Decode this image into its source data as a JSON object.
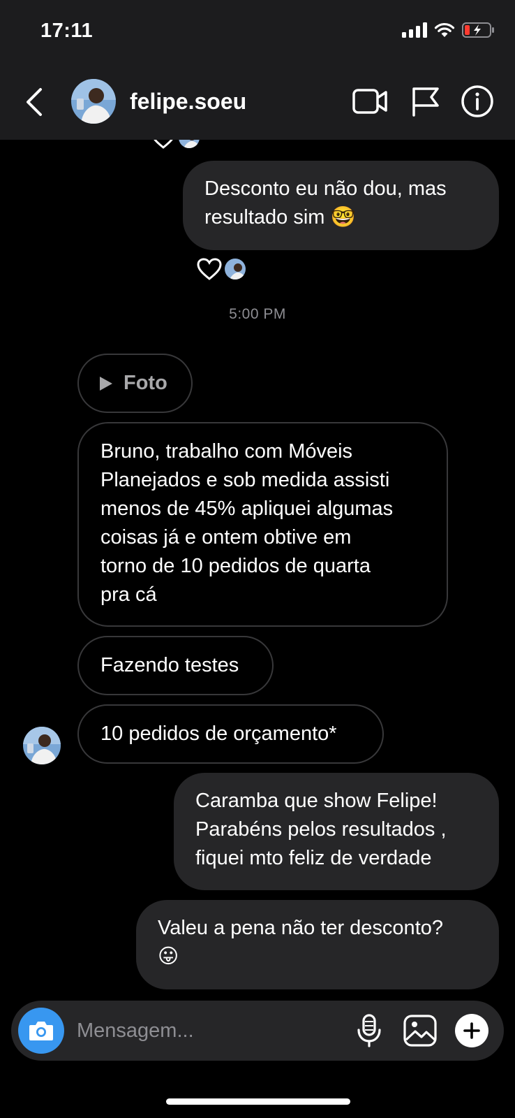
{
  "status_bar": {
    "time": "17:11"
  },
  "header": {
    "username": "felipe.soeu"
  },
  "messages": [
    {
      "text": "Desconto eu não dou, mas\nresultado sim 🤓"
    },
    {
      "text": "Bruno, trabalho com Móveis\nPlanejados e sob medida assisti\nmenos de 45% apliquei algumas\ncoisas já e ontem obtive em\ntorno de 10 pedidos de quarta\npra cá"
    },
    {
      "text": "Fazendo testes"
    },
    {
      "text": "10 pedidos de orçamento*"
    },
    {
      "text": "Caramba que show Felipe!\nParabéns pelos resultados ,\nfiquei mto feliz de verdade"
    },
    {
      "text": "Valeu a pena não ter desconto?\n😛"
    }
  ],
  "timestamp": "5:00 PM",
  "media_message": {
    "label": "Foto"
  },
  "composer": {
    "placeholder": "Mensagem..."
  },
  "colors": {
    "accent": "#3897f0",
    "sent_bubble": "#262628",
    "header_bg": "#1c1c1e",
    "battery_low": "#ff3b30"
  }
}
